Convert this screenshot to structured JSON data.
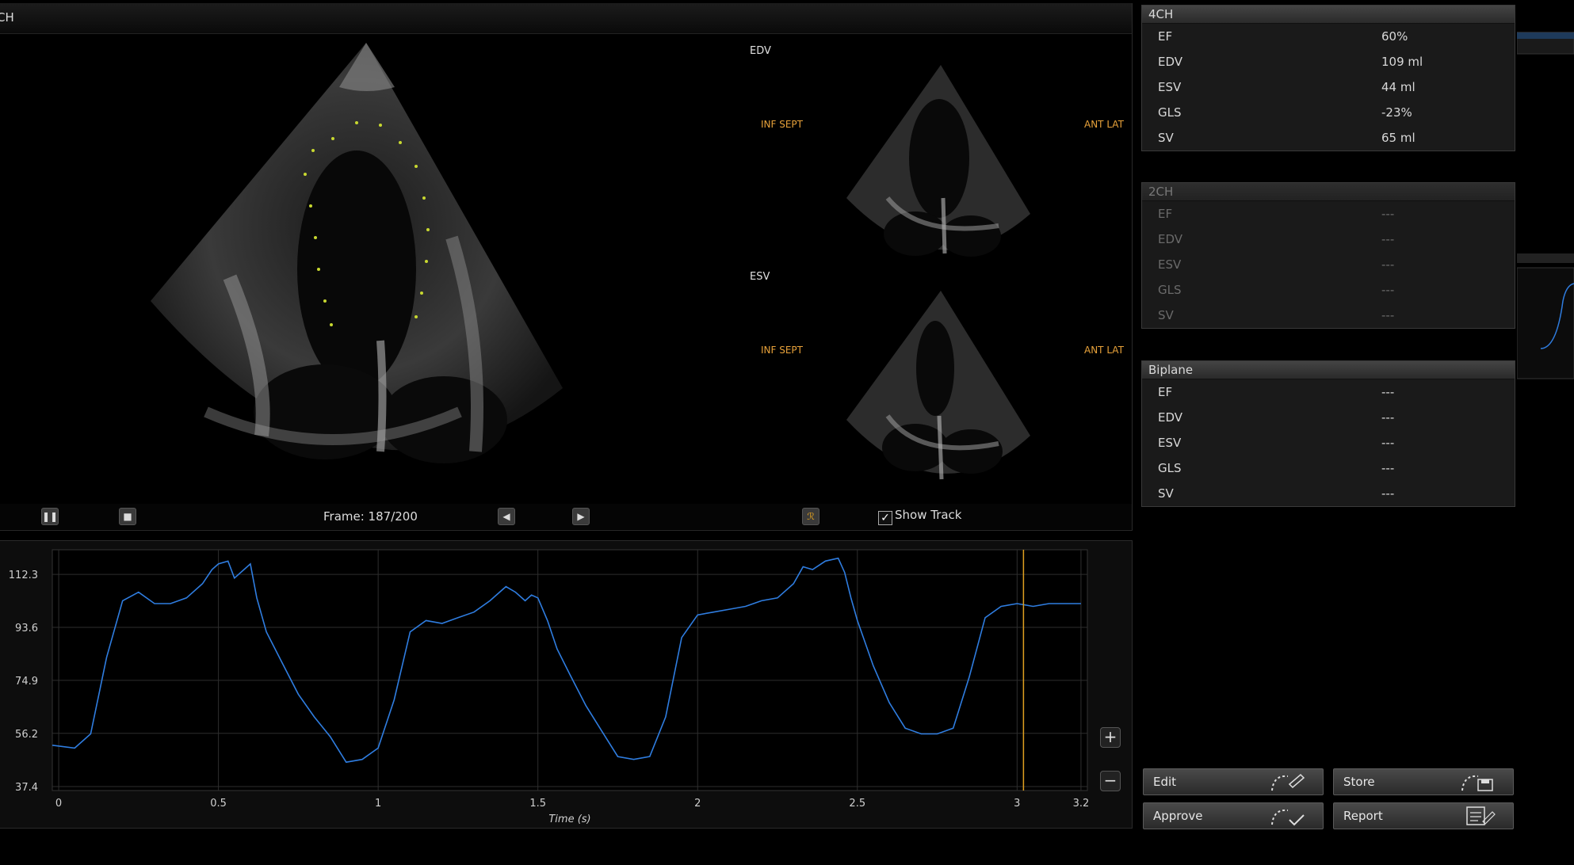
{
  "viewer": {
    "title": "CH",
    "edv_label": "EDV",
    "esv_label": "ESV",
    "edv_left_marker": "INF SEPT",
    "edv_right_marker": "ANT LAT",
    "esv_left_marker": "INF SEPT",
    "esv_right_marker": "ANT LAT"
  },
  "playback": {
    "frame_text": "Frame: 187/200",
    "show_track_label": "Show Track",
    "show_track_checked": true,
    "pause_icon": "pause-icon",
    "stop_icon": "stop-icon",
    "prev_icon": "step-back-icon",
    "next_icon": "step-forward-icon",
    "track_icon": "track-icon"
  },
  "panels": {
    "four_ch": {
      "title": "4CH",
      "rows": [
        {
          "k": "EF",
          "v": "60%"
        },
        {
          "k": "EDV",
          "v": "109 ml"
        },
        {
          "k": "ESV",
          "v": "44 ml"
        },
        {
          "k": "GLS",
          "v": "-23%"
        },
        {
          "k": "SV",
          "v": "65 ml"
        }
      ]
    },
    "two_ch": {
      "title": "2CH",
      "rows": [
        {
          "k": "EF",
          "v": "---"
        },
        {
          "k": "EDV",
          "v": "---"
        },
        {
          "k": "ESV",
          "v": "---"
        },
        {
          "k": "GLS",
          "v": "---"
        },
        {
          "k": "SV",
          "v": "---"
        }
      ]
    },
    "biplane": {
      "title": "Biplane",
      "rows": [
        {
          "k": "EF",
          "v": "---"
        },
        {
          "k": "EDV",
          "v": "---"
        },
        {
          "k": "ESV",
          "v": "---"
        },
        {
          "k": "GLS",
          "v": "---"
        },
        {
          "k": "SV",
          "v": "---"
        }
      ]
    }
  },
  "actions": {
    "edit": "Edit",
    "store": "Store",
    "approve": "Approve",
    "report": "Report"
  },
  "zoom": {
    "plus": "+",
    "minus": "−"
  },
  "chart_data": {
    "type": "line",
    "xlabel": "Time (s)",
    "ylabel": "",
    "xlim": [
      -0.02,
      3.22
    ],
    "ylim": [
      36,
      121
    ],
    "x_ticks": [
      "0",
      "0.5",
      "1",
      "1.5",
      "2",
      "2.5",
      "3",
      "3.2"
    ],
    "x_tick_values": [
      0,
      0.5,
      1,
      1.5,
      2,
      2.5,
      3,
      3.2
    ],
    "y_ticks": [
      "112.3",
      "93.6",
      "74.9",
      "56.2",
      "37.4"
    ],
    "y_tick_values": [
      112.3,
      93.6,
      74.9,
      56.2,
      37.4
    ],
    "grid": true,
    "line_color": "#2f7de0",
    "cursor_color": "#e0a020",
    "cursor_x": 3.02,
    "series": [
      {
        "x": [
          -0.02,
          0.05,
          0.1,
          0.15,
          0.2,
          0.25,
          0.3,
          0.35,
          0.4,
          0.45,
          0.48,
          0.5,
          0.53,
          0.55,
          0.58,
          0.6,
          0.62,
          0.65,
          0.7,
          0.75,
          0.8,
          0.85,
          0.9,
          0.95,
          1.0,
          1.05,
          1.1,
          1.15,
          1.2,
          1.25,
          1.3,
          1.35,
          1.4,
          1.43,
          1.46,
          1.48,
          1.5,
          1.53,
          1.56,
          1.6,
          1.65,
          1.7,
          1.75,
          1.8,
          1.85,
          1.9,
          1.95,
          2.0,
          2.05,
          2.1,
          2.15,
          2.2,
          2.25,
          2.3,
          2.33,
          2.36,
          2.4,
          2.44,
          2.46,
          2.48,
          2.5,
          2.55,
          2.6,
          2.65,
          2.7,
          2.75,
          2.8,
          2.85,
          2.9,
          2.95,
          3.0,
          3.05,
          3.1,
          3.15,
          3.2
        ],
        "y": [
          52,
          51,
          56,
          83,
          103,
          106,
          102,
          102,
          104,
          109,
          114,
          116,
          117,
          111,
          114,
          116,
          104,
          92,
          81,
          70,
          62,
          55,
          46,
          47,
          51,
          68,
          92,
          96,
          95,
          97,
          99,
          103,
          108,
          106,
          103,
          105,
          104,
          96,
          86,
          77,
          66,
          57,
          48,
          47,
          48,
          62,
          90,
          98,
          99,
          100,
          101,
          103,
          104,
          109,
          115,
          114,
          117,
          118,
          113,
          104,
          96,
          80,
          67,
          58,
          56,
          56,
          58,
          76,
          97,
          101,
          102,
          101,
          102,
          102,
          102
        ]
      }
    ]
  }
}
